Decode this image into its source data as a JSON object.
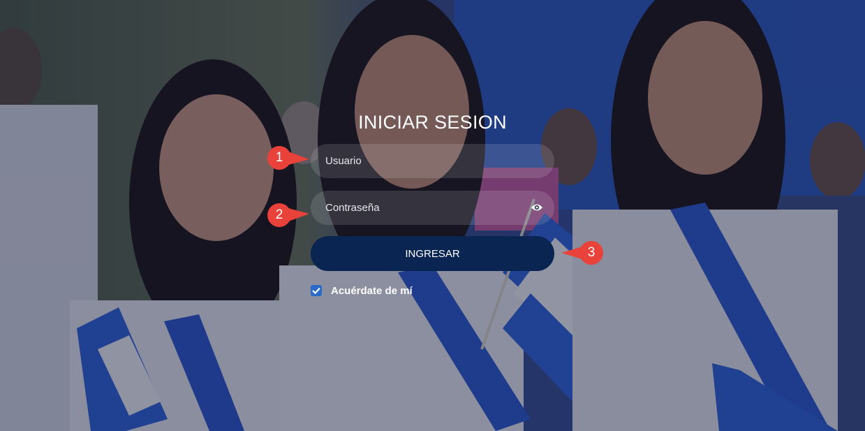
{
  "login": {
    "title": "INICIAR SESION",
    "username_placeholder": "Usuario",
    "password_placeholder": "Contraseña",
    "submit_label": "INGRESAR",
    "remember_label": "Acuérdate de mí",
    "remember_checked": true
  },
  "callouts": [
    "1",
    "2",
    "3"
  ],
  "colors": {
    "button": "#0a2552",
    "checkbox": "#2a6ac9",
    "callout": "#e8423a"
  },
  "icons": {
    "password_toggle": "eye-icon",
    "checkbox": "check-icon"
  }
}
